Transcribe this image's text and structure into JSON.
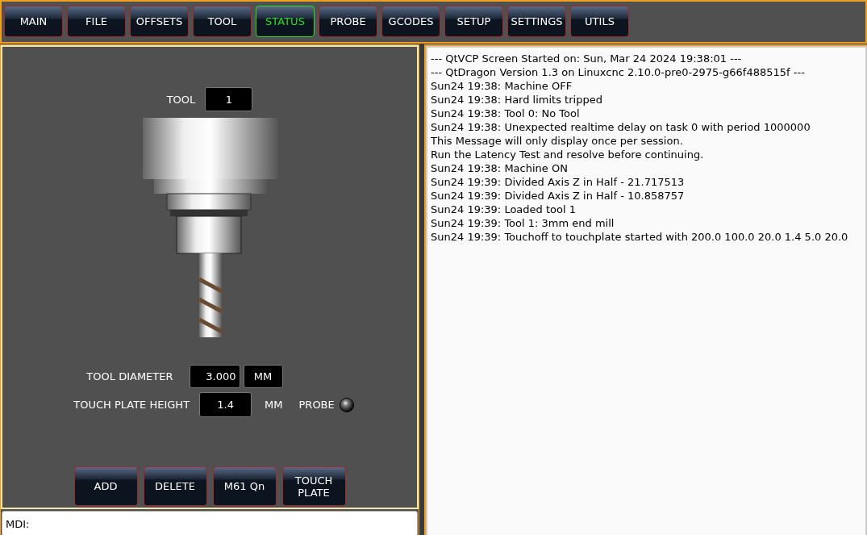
{
  "tabs": [
    {
      "label": "MAIN",
      "selected": false
    },
    {
      "label": "FILE",
      "selected": false
    },
    {
      "label": "OFFSETS",
      "selected": false
    },
    {
      "label": "TOOL",
      "selected": false
    },
    {
      "label": "STATUS",
      "selected": true
    },
    {
      "label": "PROBE",
      "selected": false
    },
    {
      "label": "GCODES",
      "selected": false
    },
    {
      "label": "SETUP",
      "selected": false
    },
    {
      "label": "SETTINGS",
      "selected": false
    },
    {
      "label": "UTILS",
      "selected": false
    }
  ],
  "tool": {
    "label": "TOOL",
    "value": "1"
  },
  "diameter": {
    "label": "TOOL DIAMETER",
    "value": "3.000",
    "unit": "MM"
  },
  "plate": {
    "label": "TOUCH PLATE HEIGHT",
    "value": "1.4",
    "unit": "MM"
  },
  "probe": {
    "label": "PROBE",
    "on": false
  },
  "buttons": [
    "ADD",
    "DELETE",
    "M61 Qn",
    "TOUCH PLATE"
  ],
  "mdi": {
    "label": "MDI:"
  },
  "log": [
    "--- QtVCP Screen Started on: Sun, Mar 24 2024 19:38:01 ---",
    "--- QtDragon Version 1.3 on Linuxcnc 2.10.0-pre0-2975-g66f488515f ---",
    "Sun24 19:38: Machine OFF",
    "Sun24 19:38: Hard limits tripped",
    "Sun24 19:38: Tool 0: No Tool",
    "Sun24 19:38: Unexpected realtime delay on task 0 with period 1000000",
    "This Message will only display once per session.",
    "Run the Latency Test and resolve before continuing.",
    "Sun24 19:38: Machine ON",
    "Sun24 19:39: Divided Axis Z in Half - 21.717513",
    "Sun24 19:39: Divided Axis Z in Half - 10.858757",
    "Sun24 19:39: Loaded tool 1",
    "Sun24 19:39: Tool 1: 3mm end mill",
    "Sun24 19:39: Touchoff to touchplate started with 200.0 100.0 20.0 1.4 5.0 20.0"
  ]
}
